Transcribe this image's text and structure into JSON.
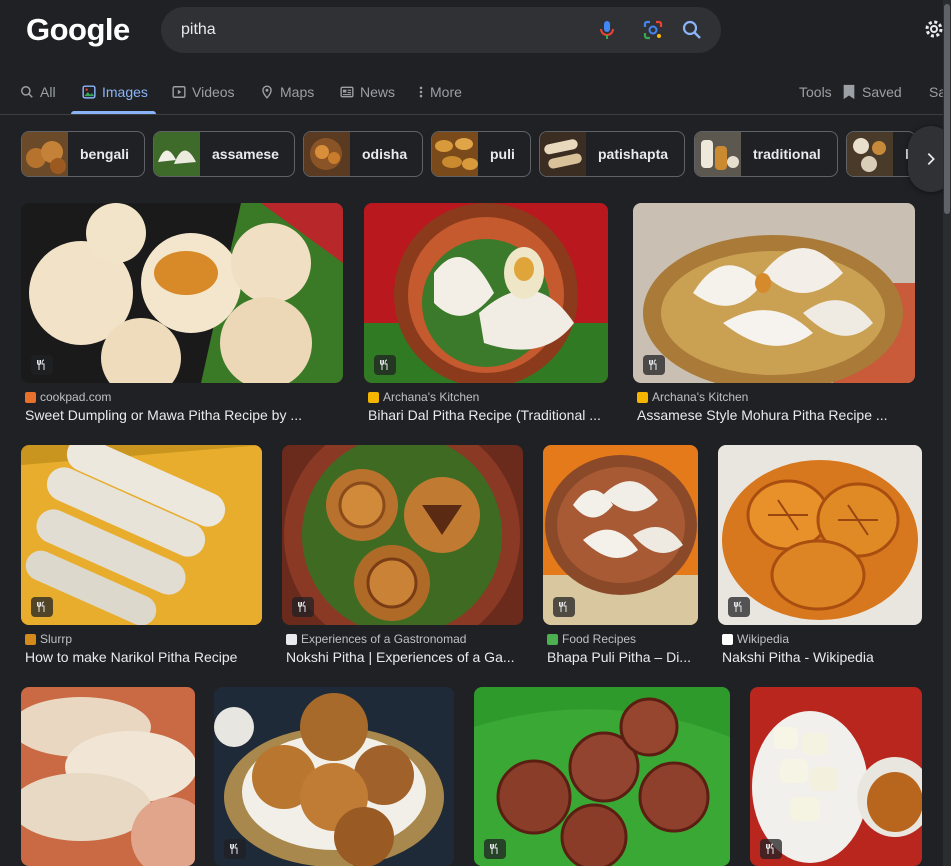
{
  "header": {
    "logo": "Google",
    "query": "pitha"
  },
  "tabs": [
    {
      "label": "All",
      "icon": "search-icon"
    },
    {
      "label": "Images",
      "icon": "images-icon",
      "active": true
    },
    {
      "label": "Videos",
      "icon": "video-icon"
    },
    {
      "label": "Maps",
      "icon": "map-pin-icon"
    },
    {
      "label": "News",
      "icon": "news-icon"
    },
    {
      "label": "More",
      "icon": "more-vert-icon"
    }
  ],
  "tools": {
    "tools_label": "Tools",
    "saved_label": "Saved",
    "safesearch_label": "Sa"
  },
  "chips": [
    {
      "label": "bengali"
    },
    {
      "label": "assamese"
    },
    {
      "label": "odisha"
    },
    {
      "label": "puli"
    },
    {
      "label": "patishapta"
    },
    {
      "label": "traditional"
    },
    {
      "label": "b"
    }
  ],
  "results": [
    {
      "source": "cookpad.com",
      "title": "Sweet Dumpling or Mawa Pitha Recipe by ...",
      "fav_color": "#e9712c"
    },
    {
      "source": "Archana's Kitchen",
      "title": "Bihari Dal Pitha Recipe (Traditional ...",
      "fav_color": "#f4b400"
    },
    {
      "source": "Archana's Kitchen",
      "title": "Assamese Style Mohura Pitha Recipe ...",
      "fav_color": "#f4b400"
    },
    {
      "source": "Slurrp",
      "title": "How to make Narikol Pitha Recipe",
      "fav_color": "#d48a1a"
    },
    {
      "source": "Experiences of a Gastronomad",
      "title": "Nokshi Pitha | Experiences of a Ga...",
      "fav_color": "#e8eaed"
    },
    {
      "source": "Food Recipes",
      "title": "Bhapa Puli Pitha – Di...",
      "fav_color": "#4caf50"
    },
    {
      "source": "Wikipedia",
      "title": "Nakshi Pitha - Wikipedia",
      "fav_color": "#ffffff"
    },
    {
      "source": "",
      "title": "",
      "fav_color": ""
    },
    {
      "source": "",
      "title": "",
      "fav_color": ""
    },
    {
      "source": "",
      "title": "",
      "fav_color": ""
    },
    {
      "source": "",
      "title": "",
      "fav_color": ""
    }
  ],
  "colors": {
    "background": "#202124",
    "accent": "#8ab4f8",
    "searchbox": "#303134"
  }
}
